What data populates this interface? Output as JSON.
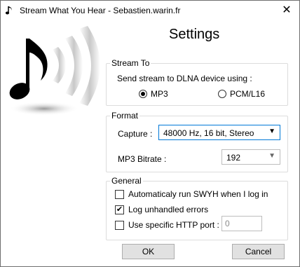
{
  "window": {
    "title": "Stream What You Hear - Sebastien.warin.fr",
    "close_glyph": "✕"
  },
  "heading": "Settings",
  "stream_to": {
    "legend": "Stream To",
    "prompt": "Send stream to DLNA device using :",
    "options": [
      {
        "label": "MP3",
        "selected": true
      },
      {
        "label": "PCM/L16",
        "selected": false
      }
    ]
  },
  "format": {
    "legend": "Format",
    "capture_label": "Capture :",
    "capture_value": "48000 Hz, 16 bit, Stereo",
    "bitrate_label": "MP3 Bitrate :",
    "bitrate_value": "192"
  },
  "general": {
    "legend": "General",
    "autorun_label": "Automaticaly run SWYH when I log in",
    "autorun_checked": false,
    "log_label": "Log unhandled errors",
    "log_checked": true,
    "port_label": "Use specific HTTP port :",
    "port_checked": false,
    "port_value": "0"
  },
  "buttons": {
    "ok": "OK",
    "cancel": "Cancel"
  },
  "icons": {
    "app": "music-note-icon",
    "close": "close-icon",
    "logo": "music-note-sound-waves-icon",
    "dropdown": "chevron-down-icon",
    "check": "checkmark-icon"
  },
  "colors": {
    "capture_border": "#0078d7",
    "button_face": "#e1e1e1",
    "fieldset_border": "#dcdcdc"
  }
}
